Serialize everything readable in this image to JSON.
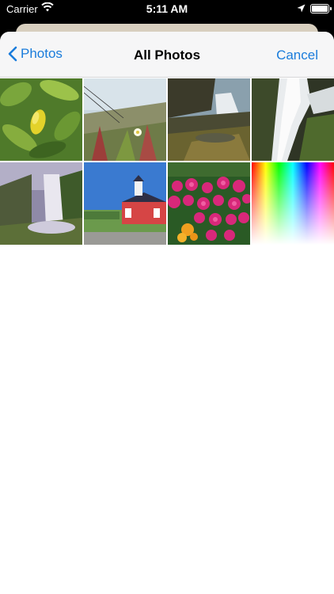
{
  "status_bar": {
    "carrier": "Carrier",
    "time": "5:11 AM"
  },
  "nav": {
    "back_label": "Photos",
    "title": "All Photos",
    "cancel_label": "Cancel",
    "accent_color": "#1a7cdb"
  },
  "photos": [
    {
      "subject": "lemon-tree"
    },
    {
      "subject": "beach-dune-plants"
    },
    {
      "subject": "waterfall-rocks"
    },
    {
      "subject": "waterfall-longexposure"
    },
    {
      "subject": "waterfall-cliff"
    },
    {
      "subject": "red-schoolhouse"
    },
    {
      "subject": "pink-flowers"
    },
    {
      "subject": "color-spectrum"
    }
  ]
}
